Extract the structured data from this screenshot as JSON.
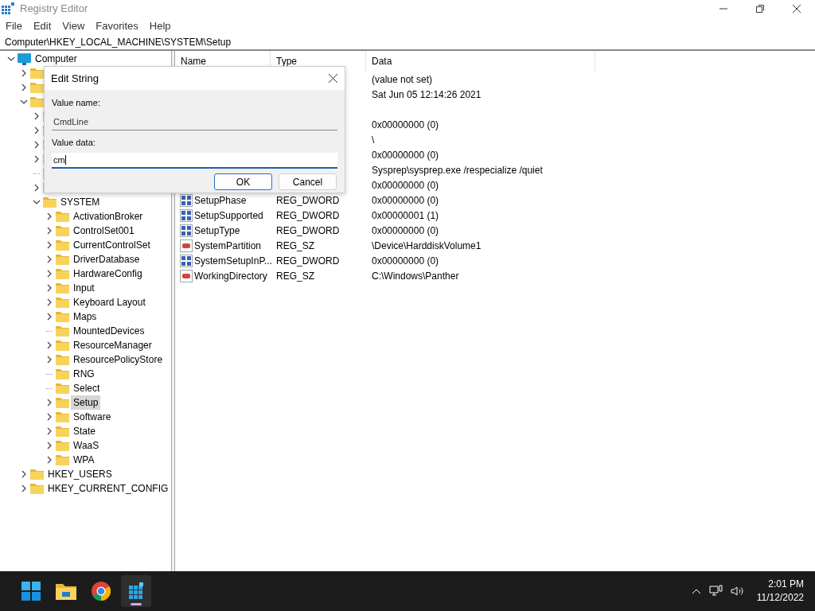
{
  "window": {
    "title": "Registry Editor"
  },
  "menu": [
    "File",
    "Edit",
    "View",
    "Favorites",
    "Help"
  ],
  "address": "Computer\\HKEY_LOCAL_MACHINE\\SYSTEM\\Setup",
  "tree": [
    {
      "name": "Computer",
      "kind": "computer",
      "expanded": true,
      "selected": false,
      "children": [
        {
          "kind": "folder",
          "expanded": false,
          "selected": false
        },
        {
          "kind": "folder",
          "expanded": false,
          "selected": false
        },
        {
          "kind": "folder",
          "expanded": true,
          "selected": false,
          "children": [
            {
              "kind": "folder",
              "expanded": false,
              "selected": false
            },
            {
              "kind": "folder",
              "expanded": false,
              "selected": false
            },
            {
              "kind": "folder",
              "expanded": false,
              "selected": false
            },
            {
              "kind": "folder",
              "expanded": false,
              "selected": false
            },
            {
              "kind": "leaf",
              "selected": false
            },
            {
              "kind": "folder",
              "expanded": false,
              "selected": false
            },
            {
              "name": "SYSTEM",
              "kind": "folder",
              "expanded": true,
              "selected": false,
              "children": [
                {
                  "name": "ActivationBroker",
                  "kind": "folder",
                  "expanded": false,
                  "selected": false
                },
                {
                  "name": "ControlSet001",
                  "kind": "folder",
                  "expanded": false,
                  "selected": false
                },
                {
                  "name": "CurrentControlSet",
                  "kind": "folder",
                  "expanded": false,
                  "selected": false
                },
                {
                  "name": "DriverDatabase",
                  "kind": "folder",
                  "expanded": false,
                  "selected": false
                },
                {
                  "name": "HardwareConfig",
                  "kind": "folder",
                  "expanded": false,
                  "selected": false
                },
                {
                  "name": "Input",
                  "kind": "folder",
                  "expanded": false,
                  "selected": false
                },
                {
                  "name": "Keyboard Layout",
                  "kind": "folder",
                  "expanded": false,
                  "selected": false
                },
                {
                  "name": "Maps",
                  "kind": "folder",
                  "expanded": false,
                  "selected": false
                },
                {
                  "name": "MountedDevices",
                  "kind": "leaf",
                  "selected": false
                },
                {
                  "name": "ResourceManager",
                  "kind": "folder",
                  "expanded": false,
                  "selected": false
                },
                {
                  "name": "ResourcePolicyStore",
                  "kind": "folder",
                  "expanded": false,
                  "selected": false
                },
                {
                  "name": "RNG",
                  "kind": "leaf",
                  "selected": false
                },
                {
                  "name": "Select",
                  "kind": "leaf",
                  "selected": false
                },
                {
                  "name": "Setup",
                  "kind": "folder",
                  "expanded": false,
                  "selected": true
                },
                {
                  "name": "Software",
                  "kind": "folder",
                  "expanded": false,
                  "selected": false
                },
                {
                  "name": "State",
                  "kind": "folder",
                  "expanded": false,
                  "selected": false
                },
                {
                  "name": "WaaS",
                  "kind": "folder",
                  "expanded": false,
                  "selected": false
                },
                {
                  "name": "WPA",
                  "kind": "folder",
                  "expanded": false,
                  "selected": false
                }
              ]
            }
          ]
        },
        {
          "name": "HKEY_USERS",
          "kind": "folder",
          "expanded": false,
          "selected": false
        },
        {
          "name": "HKEY_CURRENT_CONFIG",
          "kind": "folder",
          "expanded": false,
          "selected": false
        }
      ]
    }
  ],
  "columns": [
    "Name",
    "Type",
    "Data"
  ],
  "values": [
    {
      "data": "(value not set)"
    },
    {
      "data": "Sat Jun 05 12:14:26 2021"
    },
    {
      "kind": "blank"
    },
    {
      "data": "0x00000000 (0)"
    },
    {
      "data": "\\"
    },
    {
      "data": "0x00000000 (0)"
    },
    {
      "data": "Sysprep\\sysprep.exe /respecialize /quiet"
    },
    {
      "data": "0x00000000 (0)"
    },
    {
      "kind": "dword",
      "name": "SetupPhase",
      "type": "REG_DWORD",
      "data": "0x00000000 (0)"
    },
    {
      "kind": "dword",
      "name": "SetupSupported",
      "type": "REG_DWORD",
      "data": "0x00000001 (1)"
    },
    {
      "kind": "dword",
      "name": "SetupType",
      "type": "REG_DWORD",
      "data": "0x00000000 (0)"
    },
    {
      "kind": "string",
      "name": "SystemPartition",
      "type": "REG_SZ",
      "data": "\\Device\\HarddiskVolume1"
    },
    {
      "kind": "dword",
      "name": "SystemSetupInP...",
      "type": "REG_DWORD",
      "data": "0x00000000 (0)"
    },
    {
      "kind": "string",
      "name": "WorkingDirectory",
      "type": "REG_SZ",
      "data": "C:\\Windows\\Panther"
    }
  ],
  "dialog": {
    "title": "Edit String",
    "name_label": "Value name:",
    "name_value": "CmdLine",
    "data_label": "Value data:",
    "data_value": "cm",
    "buttons": [
      {
        "label": "OK",
        "default": true
      },
      {
        "label": "Cancel",
        "default": false
      }
    ]
  },
  "taskbar": {
    "apps": [
      {
        "kind": "start",
        "active": false
      },
      {
        "kind": "explorer",
        "active": false
      },
      {
        "kind": "chrome",
        "active": false
      },
      {
        "kind": "regedit",
        "active": true
      }
    ],
    "time": "2:01 PM",
    "date": "11/12/2022"
  }
}
